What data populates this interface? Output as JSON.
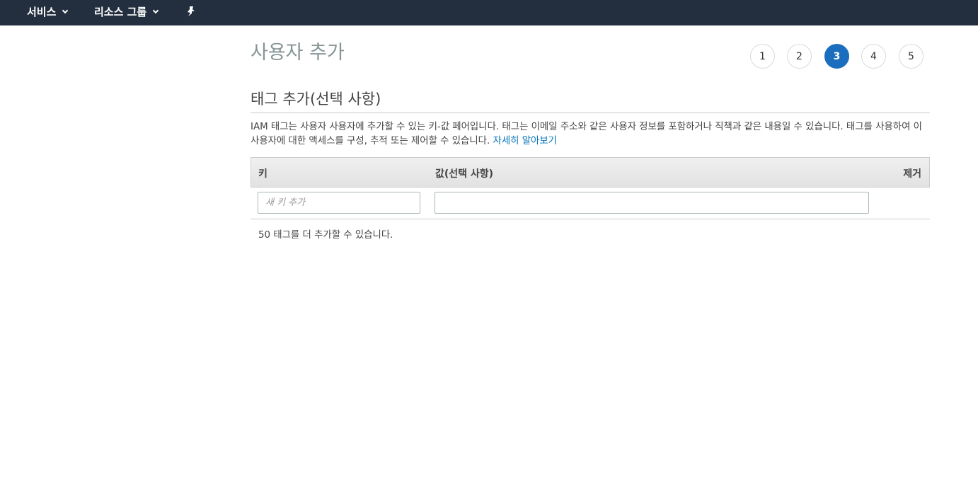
{
  "topnav": {
    "services_label": "서비스",
    "resource_groups_label": "리소스 그룹",
    "pin_icon": "pin-icon"
  },
  "page": {
    "title": "사용자 추가"
  },
  "steps": [
    {
      "label": "1",
      "active": false
    },
    {
      "label": "2",
      "active": false
    },
    {
      "label": "3",
      "active": true
    },
    {
      "label": "4",
      "active": false
    },
    {
      "label": "5",
      "active": false
    }
  ],
  "section": {
    "title": "태그 추가(선택 사항)",
    "description": "IAM 태그는 사용자 사용자에 추가할 수 있는 키-값 페어입니다. 태그는 이메일 주소와 같은 사용자 정보를 포함하거나 직책과 같은 내용일 수 있습니다. 태그를 사용하여 이 사용자에 대한 액세스를 구성, 추적 또는 제어할 수 있습니다.",
    "learn_more_link": "자세히 알아보기"
  },
  "table": {
    "headers": {
      "key": "키",
      "value": "값(선택 사항)",
      "remove": "제거"
    },
    "row": {
      "key_placeholder": "새 키 추가",
      "key_value": "",
      "value_value": ""
    }
  },
  "remaining_text": "50 태그를 더 추가할 수 있습니다.",
  "colors": {
    "nav_bg": "#232f3e",
    "active_step": "#1a6ebd",
    "link": "#0073bb"
  }
}
